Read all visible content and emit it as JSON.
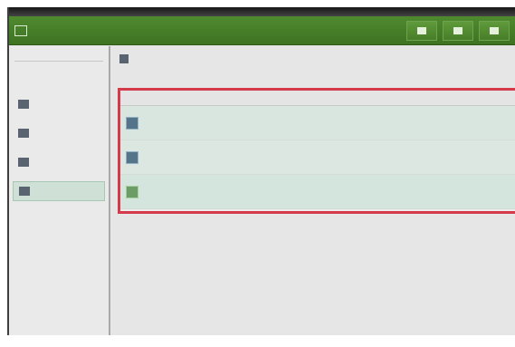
{
  "window": {
    "title": ""
  },
  "toolbar": {
    "app_title": ""
  },
  "sidebar": {
    "header": "",
    "items": [
      {
        "label": "",
        "icon": "disk-icon"
      },
      {
        "label": "",
        "icon": "disk-icon"
      },
      {
        "label": "",
        "icon": "disk-icon"
      },
      {
        "label": "",
        "icon": "disk-icon"
      }
    ],
    "active_index": 3
  },
  "breadcrumb": {
    "label": ""
  },
  "table": {
    "columns": [
      "",
      "",
      "",
      ""
    ],
    "rows": [
      {
        "name": "",
        "col2": "",
        "col3": "",
        "col4": ""
      },
      {
        "name": "",
        "col2": "",
        "col3": "",
        "col4": ""
      },
      {
        "name": "",
        "col2": "",
        "col3": "",
        "col4": ""
      }
    ]
  },
  "colors": {
    "toolbar_green": "#4f8a2f",
    "highlight_red": "#d43a4a",
    "row_tint": "#d8e6df"
  }
}
